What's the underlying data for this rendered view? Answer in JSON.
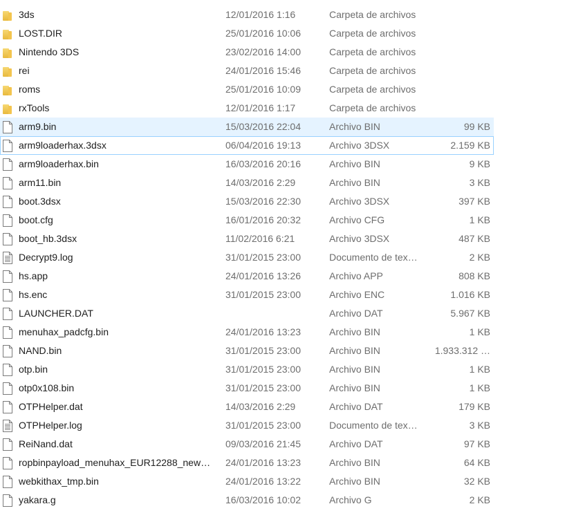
{
  "files": [
    {
      "name": "3ds",
      "date": "12/01/2016 1:16",
      "type": "Carpeta de archivos",
      "size": "",
      "icon": "folder-icon"
    },
    {
      "name": "LOST.DIR",
      "date": "25/01/2016 10:06",
      "type": "Carpeta de archivos",
      "size": "",
      "icon": "folder-icon"
    },
    {
      "name": "Nintendo 3DS",
      "date": "23/02/2016 14:00",
      "type": "Carpeta de archivos",
      "size": "",
      "icon": "folder-icon"
    },
    {
      "name": "rei",
      "date": "24/01/2016 15:46",
      "type": "Carpeta de archivos",
      "size": "",
      "icon": "folder-icon"
    },
    {
      "name": "roms",
      "date": "25/01/2016 10:09",
      "type": "Carpeta de archivos",
      "size": "",
      "icon": "folder-icon"
    },
    {
      "name": "rxTools",
      "date": "12/01/2016 1:17",
      "type": "Carpeta de archivos",
      "size": "",
      "icon": "folder-icon"
    },
    {
      "name": "arm9.bin",
      "date": "15/03/2016 22:04",
      "type": "Archivo BIN",
      "size": "99 KB",
      "icon": "file-icon",
      "state": "hover"
    },
    {
      "name": "arm9loaderhax.3dsx",
      "date": "06/04/2016 19:13",
      "type": "Archivo 3DSX",
      "size": "2.159 KB",
      "icon": "file-icon",
      "state": "focused"
    },
    {
      "name": "arm9loaderhax.bin",
      "date": "16/03/2016 20:16",
      "type": "Archivo BIN",
      "size": "9 KB",
      "icon": "file-icon"
    },
    {
      "name": "arm11.bin",
      "date": "14/03/2016 2:29",
      "type": "Archivo BIN",
      "size": "3 KB",
      "icon": "file-icon"
    },
    {
      "name": "boot.3dsx",
      "date": "15/03/2016 22:30",
      "type": "Archivo 3DSX",
      "size": "397 KB",
      "icon": "file-icon"
    },
    {
      "name": "boot.cfg",
      "date": "16/01/2016 20:32",
      "type": "Archivo CFG",
      "size": "1 KB",
      "icon": "file-icon"
    },
    {
      "name": "boot_hb.3dsx",
      "date": "11/02/2016 6:21",
      "type": "Archivo 3DSX",
      "size": "487 KB",
      "icon": "file-icon"
    },
    {
      "name": "Decrypt9.log",
      "date": "31/01/2015 23:00",
      "type": "Documento de tex…",
      "size": "2 KB",
      "icon": "text-file-icon"
    },
    {
      "name": "hs.app",
      "date": "24/01/2016 13:26",
      "type": "Archivo APP",
      "size": "808 KB",
      "icon": "file-icon"
    },
    {
      "name": "hs.enc",
      "date": "31/01/2015 23:00",
      "type": "Archivo ENC",
      "size": "1.016 KB",
      "icon": "file-icon"
    },
    {
      "name": "LAUNCHER.DAT",
      "date": "",
      "type": "Archivo DAT",
      "size": "5.967 KB",
      "icon": "file-icon"
    },
    {
      "name": "menuhax_padcfg.bin",
      "date": "24/01/2016 13:23",
      "type": "Archivo BIN",
      "size": "1 KB",
      "icon": "file-icon"
    },
    {
      "name": "NAND.bin",
      "date": "31/01/2015 23:00",
      "type": "Archivo BIN",
      "size": "1.933.312 …",
      "icon": "file-icon"
    },
    {
      "name": "otp.bin",
      "date": "31/01/2015 23:00",
      "type": "Archivo BIN",
      "size": "1 KB",
      "icon": "file-icon"
    },
    {
      "name": "otp0x108.bin",
      "date": "31/01/2015 23:00",
      "type": "Archivo BIN",
      "size": "1 KB",
      "icon": "file-icon"
    },
    {
      "name": "OTPHelper.dat",
      "date": "14/03/2016 2:29",
      "type": "Archivo DAT",
      "size": "179 KB",
      "icon": "file-icon"
    },
    {
      "name": "OTPHelper.log",
      "date": "31/01/2015 23:00",
      "type": "Documento de tex…",
      "size": "3 KB",
      "icon": "text-file-icon"
    },
    {
      "name": "ReiNand.dat",
      "date": "09/03/2016 21:45",
      "type": "Archivo DAT",
      "size": "97 KB",
      "icon": "file-icon"
    },
    {
      "name": "ropbinpayload_menuhax_EUR12288_new…",
      "date": "24/01/2016 13:23",
      "type": "Archivo BIN",
      "size": "64 KB",
      "icon": "file-icon"
    },
    {
      "name": "webkithax_tmp.bin",
      "date": "24/01/2016 13:22",
      "type": "Archivo BIN",
      "size": "32 KB",
      "icon": "file-icon"
    },
    {
      "name": "yakara.g",
      "date": "16/03/2016 10:02",
      "type": "Archivo G",
      "size": "2 KB",
      "icon": "file-icon"
    }
  ],
  "colors": {
    "hover_bg": "#e5f3ff",
    "focus_border": "#99d1ff",
    "folder": "#e8b93d"
  }
}
